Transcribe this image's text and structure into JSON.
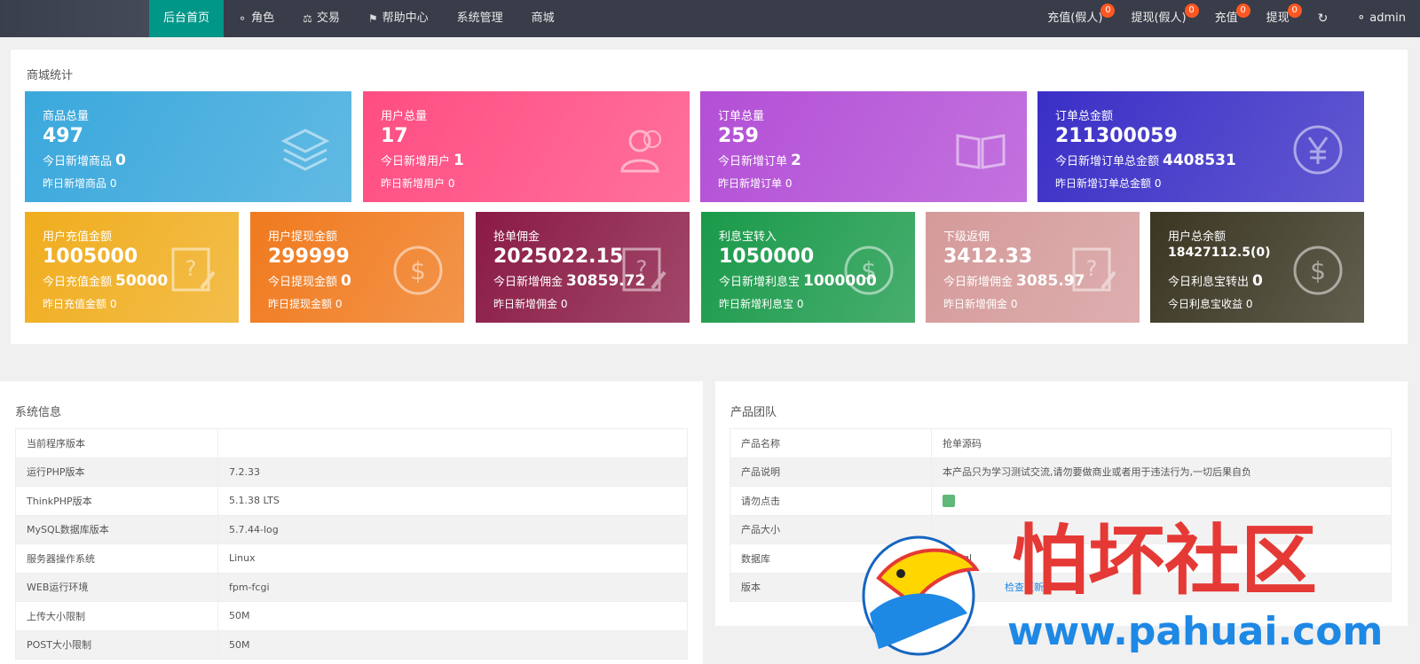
{
  "nav": {
    "items": [
      {
        "label": "后台首页",
        "icon": ""
      },
      {
        "label": "角色",
        "icon": "user-icon"
      },
      {
        "label": "交易",
        "icon": "scale-icon"
      },
      {
        "label": "帮助中心",
        "icon": "flag-icon"
      },
      {
        "label": "系统管理",
        "icon": ""
      },
      {
        "label": "商城",
        "icon": ""
      }
    ],
    "right": [
      {
        "label": "充值(假人)",
        "badge": "0"
      },
      {
        "label": "提现(假人)",
        "badge": "0"
      },
      {
        "label": "充值",
        "badge": "0"
      },
      {
        "label": "提现",
        "badge": "0"
      }
    ],
    "user": "admin"
  },
  "stats": {
    "title": "商城统计",
    "cards": [
      {
        "title": "商品总量",
        "value": "497",
        "row1_label": "今日新增商品",
        "row1_value": "0",
        "row2": "昨日新增商品 0",
        "icon": "layers-icon",
        "color": "#3aa8dc"
      },
      {
        "title": "用户总量",
        "value": "17",
        "row1_label": "今日新增用户",
        "row1_value": "1",
        "row2": "昨日新增用户 0",
        "icon": "users-icon",
        "color": "#ff4d82"
      },
      {
        "title": "订单总量",
        "value": "259",
        "row1_label": "今日新增订单",
        "row1_value": "2",
        "row2": "昨日新增订单 0",
        "icon": "book-icon",
        "color": "#b34fd6"
      },
      {
        "title": "订单总金额",
        "value": "211300059",
        "row1_label": "今日新增订单总金额",
        "row1_value": "4408531",
        "row2": "昨日新增订单总金额 0",
        "icon": "yen-icon",
        "color": "#3a2fc6"
      },
      {
        "title": "用户充值金额",
        "value": "1005000",
        "row1_label": "今日充值金额",
        "row1_value": "50000",
        "row2": "昨日充值金额 0",
        "icon": "note-icon",
        "color": "#f0ad1e"
      },
      {
        "title": "用户提现金额",
        "value": "299999",
        "row1_label": "今日提现金额",
        "row1_value": "0",
        "row2": "昨日提现金额 0",
        "icon": "dollar-icon",
        "color": "#f07a1e"
      },
      {
        "title": "抢单佣金",
        "value": "2025022.15",
        "row1_label": "今日新增佣金",
        "row1_value": "30859.72",
        "row2": "昨日新增佣金 0",
        "icon": "note-icon",
        "color": "#8a1a45"
      },
      {
        "title": "利息宝转入",
        "value": "1050000",
        "row1_label": "今日新增利息宝",
        "row1_value": "1000000",
        "row2": "昨日新增利息宝 0",
        "icon": "dollar-icon",
        "color": "#1a9a4a"
      },
      {
        "title": "下级返佣",
        "value": "3412.33",
        "row1_label": "今日新增佣金",
        "row1_value": "3085.97",
        "row2": "昨日新增佣金 0",
        "icon": "note-icon",
        "color": "#d59a9a"
      },
      {
        "title": "用户总余额",
        "value": "18427112.5(0)",
        "row1_label": "今日利息宝转出",
        "row1_value": "0",
        "row2": "今日利息宝收益 0",
        "icon": "dollar-icon",
        "color": "#3a3622"
      }
    ]
  },
  "system": {
    "title": "系统信息",
    "rows": [
      {
        "k": "当前程序版本",
        "v": ""
      },
      {
        "k": "运行PHP版本",
        "v": "7.2.33"
      },
      {
        "k": "ThinkPHP版本",
        "v": "5.1.38 LTS"
      },
      {
        "k": "MySQL数据库版本",
        "v": "5.7.44-log"
      },
      {
        "k": "服务器操作系统",
        "v": "Linux"
      },
      {
        "k": "WEB运行环境",
        "v": "fpm-fcgi"
      },
      {
        "k": "上传大小限制",
        "v": "50M"
      },
      {
        "k": "POST大小限制",
        "v": "50M"
      }
    ]
  },
  "team": {
    "title": "产品团队",
    "rows": [
      {
        "k": "产品名称",
        "v": "抢单源码"
      },
      {
        "k": "产品说明",
        "v": "本产品只为学习测试交流,请勿要做商业或者用于违法行为,一切后果自负"
      },
      {
        "k": "请勿点击",
        "v": ""
      },
      {
        "k": "产品大小",
        "v": ""
      },
      {
        "k": "数据库",
        "v": "mysql"
      },
      {
        "k": "版本",
        "v": "检查更新"
      }
    ]
  },
  "watermark": {
    "text": "怕坏社区",
    "url": "www.pahuai.com"
  }
}
